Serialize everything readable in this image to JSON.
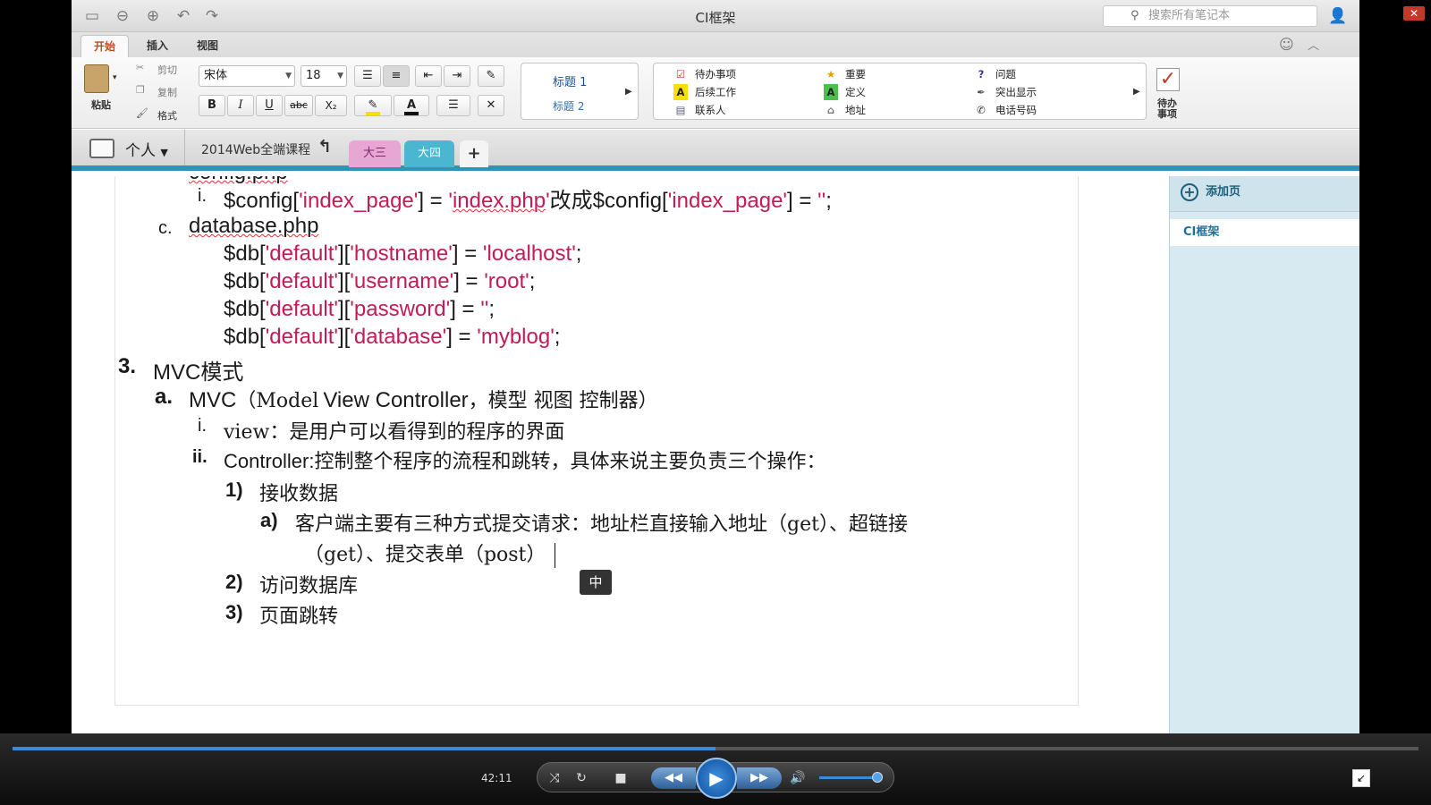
{
  "window": {
    "title": "CI框架",
    "search_placeholder": "搜索所有笔记本"
  },
  "ribbon_tabs": [
    "开始",
    "插入",
    "视图"
  ],
  "clipboard": {
    "paste": "粘贴",
    "cut": "剪切",
    "copy": "复制",
    "format": "格式"
  },
  "font": {
    "name": "宋体",
    "size": "18"
  },
  "format_buttons": {
    "bold": "B",
    "italic": "I",
    "underline": "U",
    "strike": "abc",
    "sub": "X₂"
  },
  "styles": [
    "标题 1",
    "标题 2"
  ],
  "tags": [
    {
      "label": "待办事项",
      "icon": "checkbox-icon"
    },
    {
      "label": "后续工作",
      "icon": "letter-a-icon"
    },
    {
      "label": "联系人",
      "icon": "contact-card-icon"
    },
    {
      "label": "重要",
      "icon": "star-icon"
    },
    {
      "label": "定义",
      "icon": "letter-a-green-icon"
    },
    {
      "label": "地址",
      "icon": "house-icon"
    },
    {
      "label": "问题",
      "icon": "question-icon"
    },
    {
      "label": "突出显示",
      "icon": "highlighter-pen-icon"
    },
    {
      "label": "电话号码",
      "icon": "phone-icon"
    }
  ],
  "todo_big": {
    "line1": "待办",
    "line2": "事项"
  },
  "notebook": {
    "name": "个人",
    "section_group": "2014Web全端课程",
    "sections": [
      "大三",
      "大四"
    ],
    "add": "+"
  },
  "note": {
    "b_marker": "b.",
    "b_title": "config.php",
    "i1_marker": "i.",
    "i1_pre": "$config[",
    "i1_q1": "'index_page'",
    "i1_mid1": "] = ",
    "i1_q2a": "'",
    "i1_q2b": "index.php",
    "i1_q2c": "'",
    "i1_mid2": "改成$config[",
    "i1_q3": "'index_page'",
    "i1_mid3": "] = ",
    "i1_q4": "''",
    "i1_end": ";",
    "c_marker": "c.",
    "c_title": "database.php",
    "db": [
      {
        "key": "'hostname'",
        "val": "'localhost'"
      },
      {
        "key": "'username'",
        "val": "'root'"
      },
      {
        "key": "'password'",
        "val": "''"
      },
      {
        "key": "'database'",
        "val": "'myblog'"
      }
    ],
    "db_var": "$db[",
    "db_default": "'default'",
    "s3_marker": "3.",
    "s3_text": "MVC模式",
    "a_marker": "a.",
    "a_text_1": "MVC",
    "a_text_2": "（Model",
    "a_text_3": "View Controller",
    "a_text_4": "，模型 视图 控制器）",
    "v_marker": "i.",
    "v_text": "view：是用户可以看得到的程序的界面",
    "ii_marker": "ii.",
    "ii_text_1": "Controller:",
    "ii_text_2": "控制整个程序的流程和跳转，具体来说主要负责三个操作：",
    "n1_marker": "1)",
    "n1_text": "接收数据",
    "na_marker": "a)",
    "na_text_1": "客户端主要有三种方式提交请求：地址栏直接输入地址（get）、超链接",
    "na_text_2": "（get）、提交表单（post）",
    "n2_marker": "2)",
    "n2_text": "访问数据库",
    "n3_marker": "3)",
    "n3_text": "页面跳转"
  },
  "pages_panel": {
    "add_page": "添加页",
    "pages": [
      "CI框架"
    ]
  },
  "ime": "中",
  "player": {
    "time": "42:11",
    "progress": 0.5
  },
  "colors": {
    "accent": "#2f95b7",
    "string": "#c41a55",
    "tab_daSan": "#e8a6d4",
    "tab_daSi": "#4bb6cf"
  }
}
